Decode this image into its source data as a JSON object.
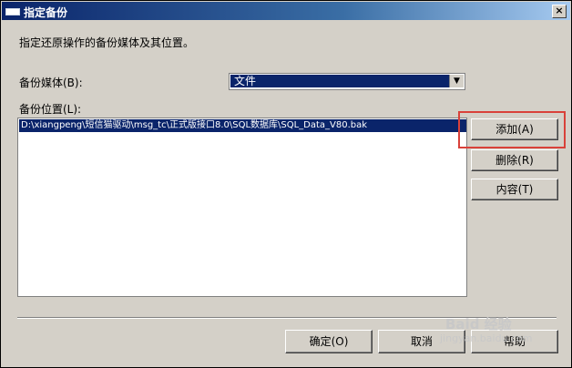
{
  "window": {
    "title": "指定备份",
    "close_label": "×"
  },
  "description": "指定还原操作的备份媒体及其位置。",
  "media": {
    "label": "备份媒体(B):",
    "selected": "文件"
  },
  "location": {
    "label": "备份位置(L):",
    "items": [
      "D:\\xiangpeng\\短信猫驱动\\msg_tc\\正式版接口8.0\\SQL数据库\\SQL_Data_V80.bak"
    ]
  },
  "side_buttons": {
    "add": "添加(A)",
    "remove": "删除(R)",
    "contents": "内容(T)"
  },
  "footer_buttons": {
    "ok": "确定(O)",
    "cancel": "取消",
    "help": "帮助"
  },
  "watermark": {
    "brand": "Baid 经验",
    "url": "jingyan.baidu.com"
  },
  "colors": {
    "titlebar_start": "#0a246a",
    "selection": "#0a246a",
    "highlight_frame": "#d9413a",
    "window_bg": "#d4d0c8"
  }
}
